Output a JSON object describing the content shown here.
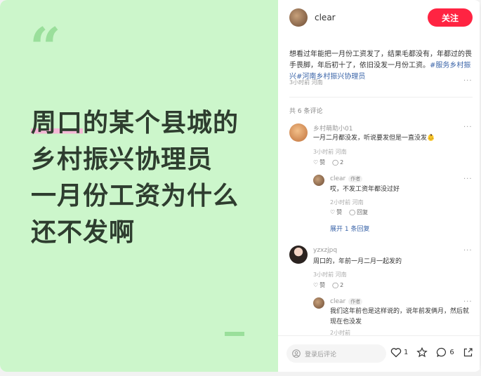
{
  "cover": {
    "quote_mark": "“",
    "headline": [
      "周口的某个县城的",
      "乡村振兴协理员",
      "一月份工资为什么",
      "还不发啊"
    ],
    "headline_highlight": "周口"
  },
  "author": {
    "name": "clear",
    "follow_label": "关注"
  },
  "post": {
    "text": "想看过年能把一月份工资发了，结果毛都没有，年都过的畏手畏脚，年后初十了，依旧没发一月份工资。",
    "tags": [
      "#服务乡村振兴",
      "#河南乡村振兴协理员"
    ],
    "meta": "3小时前 河南"
  },
  "comments_header": "共 6 条评论",
  "comments": [
    {
      "name": "乡村萌助小01",
      "text": "一月二月都没发，听说要发但是一直没发👶",
      "meta": "3小时前 河南",
      "like_label": "赞",
      "reply_count": "2",
      "replies": [
        {
          "name": "clear",
          "badge": "作者",
          "text": "哎，不发工资年都没过好",
          "meta": "2小时前 河南",
          "like_label": "赞",
          "reply_label": "回复"
        }
      ],
      "expand_label": "展开 1 条回复"
    },
    {
      "name": "yzxzjpq",
      "text": "周口的，年前一月二月一起发的",
      "meta": "3小时前 河南",
      "like_label": "赞",
      "reply_count": "2",
      "replies": [
        {
          "name": "clear",
          "badge": "作者",
          "text": "我们这年前也是这样说的，说年前发俩月，然后就现在也没发",
          "meta": "2小时前"
        }
      ]
    }
  ],
  "bottom_bar": {
    "placeholder": "登录后评论",
    "like_count": "1",
    "comment_count": "6"
  },
  "colors": {
    "cover_bg": "#ccf6cb",
    "accent": "#ff2442",
    "tag": "#3a64a8"
  }
}
